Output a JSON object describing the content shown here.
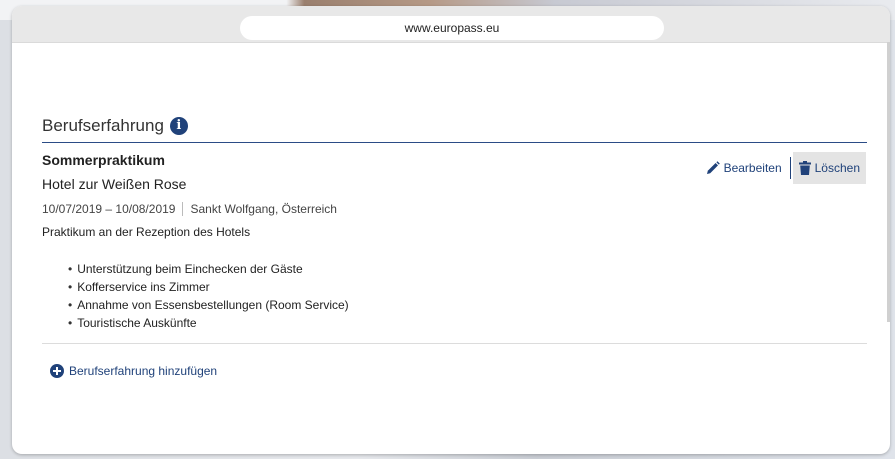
{
  "browser": {
    "url": "www.europass.eu"
  },
  "section": {
    "title": "Berufserfahrung",
    "info_icon": "info-circle-icon"
  },
  "entry": {
    "job_title": "Sommerpraktikum",
    "company": "Hotel zur Weißen Rose",
    "dates": "10/07/2019 – 10/08/2019",
    "location": "Sankt Wolfgang, Österreich",
    "description": "Praktikum an der Rezeption des Hotels",
    "bullets": [
      "Unterstützung beim Einchecken der Gäste",
      "Kofferservice ins Zimmer",
      "Annahme von Essensbestellungen (Room Service)",
      "Touristische Auskünfte"
    ],
    "actions": {
      "edit_label": "Bearbeiten",
      "edit_icon": "pencil-icon",
      "delete_label": "Löschen",
      "delete_icon": "trash-icon"
    }
  },
  "add": {
    "label": "Berufserfahrung hinzufügen",
    "icon": "plus-circle-icon"
  },
  "colors": {
    "accent": "#20427a",
    "divider": "#2b4c86"
  }
}
